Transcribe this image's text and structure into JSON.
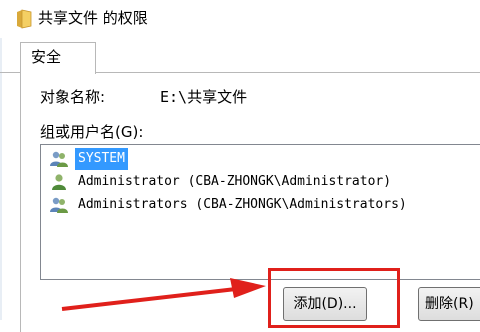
{
  "window": {
    "title": "共享文件 的权限"
  },
  "tabs": [
    {
      "label": "安全",
      "active": true
    }
  ],
  "object": {
    "label": "对象名称:",
    "value": "E:\\共享文件"
  },
  "groups": {
    "label": "组或用户名(G):",
    "items": [
      {
        "name": "SYSTEM",
        "icon": "users-group-icon",
        "selected": true
      },
      {
        "name": "Administrator (CBA-ZHONGK\\Administrator)",
        "icon": "user-icon",
        "selected": false
      },
      {
        "name": "Administrators (CBA-ZHONGK\\Administrators)",
        "icon": "users-group-icon",
        "selected": false
      }
    ]
  },
  "buttons": {
    "add_label": "添加(D)...",
    "remove_label": "删除(R)"
  },
  "annotation": {
    "color": "#e0201b"
  },
  "colors": {
    "selection": "#3399ff",
    "annotation_red": "#e0201b"
  }
}
